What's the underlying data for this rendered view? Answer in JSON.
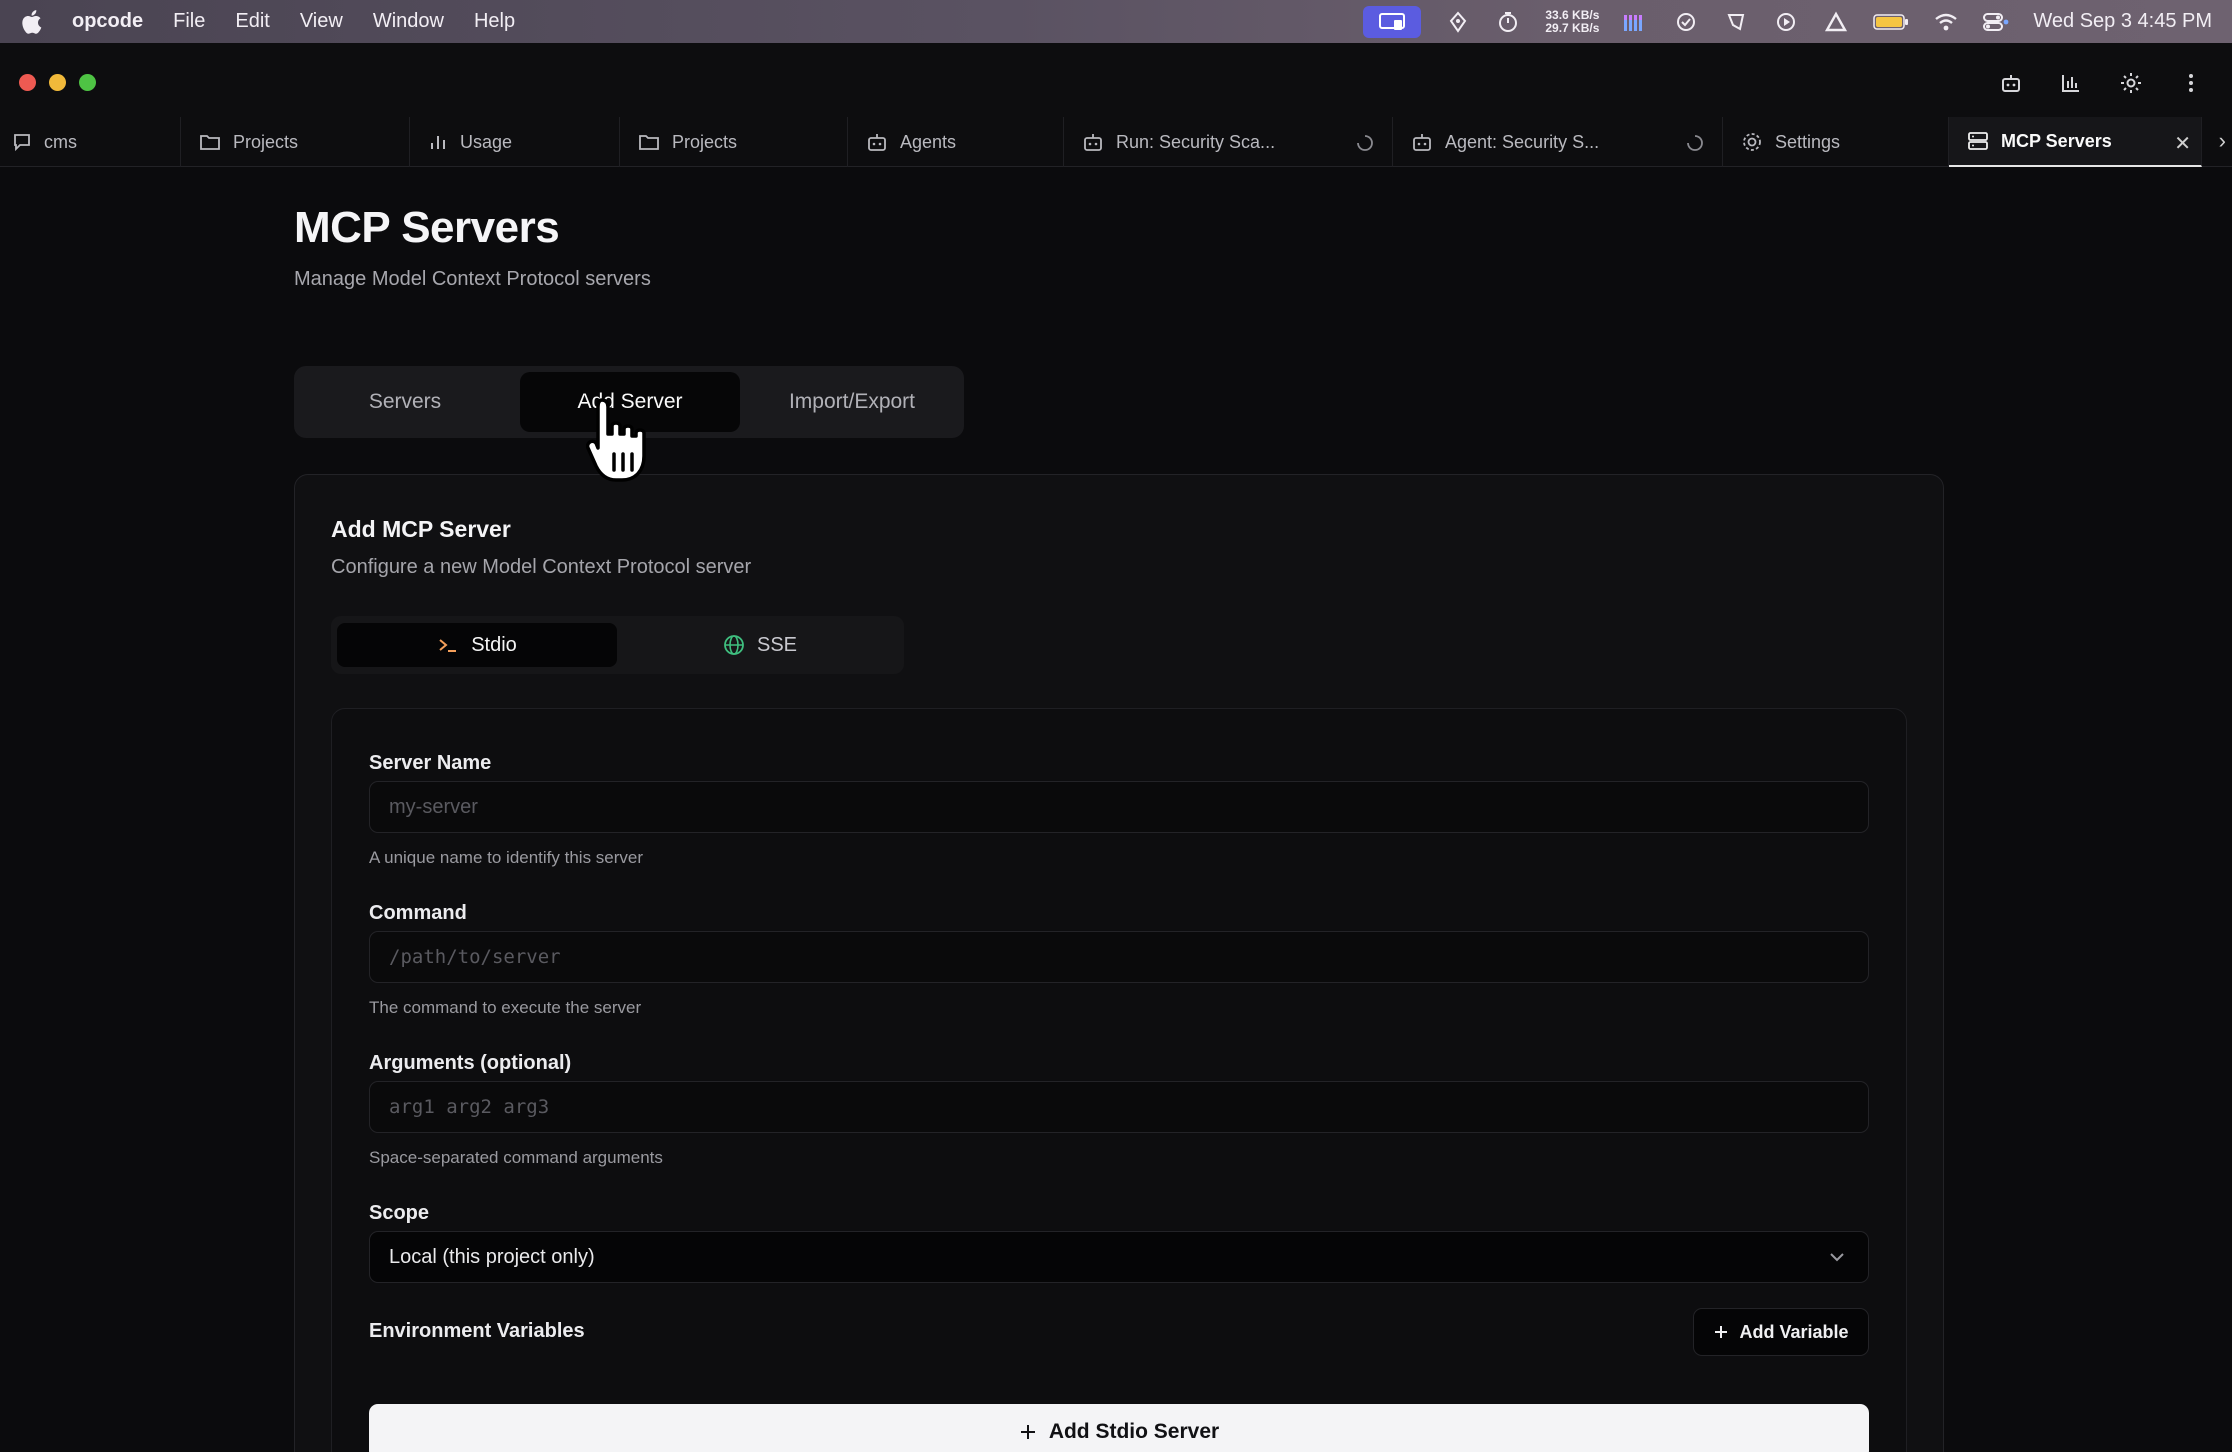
{
  "menubar": {
    "app_name": "opcode",
    "menus": [
      "File",
      "Edit",
      "View",
      "Window",
      "Help"
    ],
    "net_up": "33.6 KB/s",
    "net_down": "29.7 KB/s",
    "clock": "Wed Sep 3  4:45 PM",
    "accent": "#5b5ce0"
  },
  "tabs": [
    {
      "label": "cms",
      "icon": "chat-icon"
    },
    {
      "label": "Projects",
      "icon": "folder-icon"
    },
    {
      "label": "Usage",
      "icon": "bar-chart-icon"
    },
    {
      "label": "Projects",
      "icon": "folder-icon"
    },
    {
      "label": "Agents",
      "icon": "bot-icon"
    },
    {
      "label": "Run: Security Sca...",
      "icon": "bot-icon",
      "loading": true
    },
    {
      "label": "Agent: Security S...",
      "icon": "bot-icon",
      "loading": true
    },
    {
      "label": "Settings",
      "icon": "gear-icon"
    },
    {
      "label": "MCP Servers",
      "icon": "server-icon",
      "active": true
    }
  ],
  "page": {
    "title": "MCP Servers",
    "subtitle": "Manage Model Context Protocol servers"
  },
  "main_tabs": {
    "servers": "Servers",
    "add_server": "Add Server",
    "import_export": "Import/Export",
    "active": "add_server"
  },
  "form": {
    "title": "Add MCP Server",
    "subtitle": "Configure a new Model Context Protocol server",
    "type_stdio": "Stdio",
    "type_sse": "SSE",
    "active_type": "stdio",
    "server_name_label": "Server Name",
    "server_name_placeholder": "my-server",
    "server_name_value": "",
    "server_name_help": "A unique name to identify this server",
    "command_label": "Command",
    "command_placeholder": "/path/to/server",
    "command_value": "",
    "command_help": "The command to execute the server",
    "args_label": "Arguments (optional)",
    "args_placeholder": "arg1 arg2 arg3",
    "args_value": "",
    "args_help": "Space-separated command arguments",
    "scope_label": "Scope",
    "scope_value": "Local (this project only)",
    "env_label": "Environment Variables",
    "add_variable": "Add Variable",
    "submit": "Add Stdio Server"
  }
}
